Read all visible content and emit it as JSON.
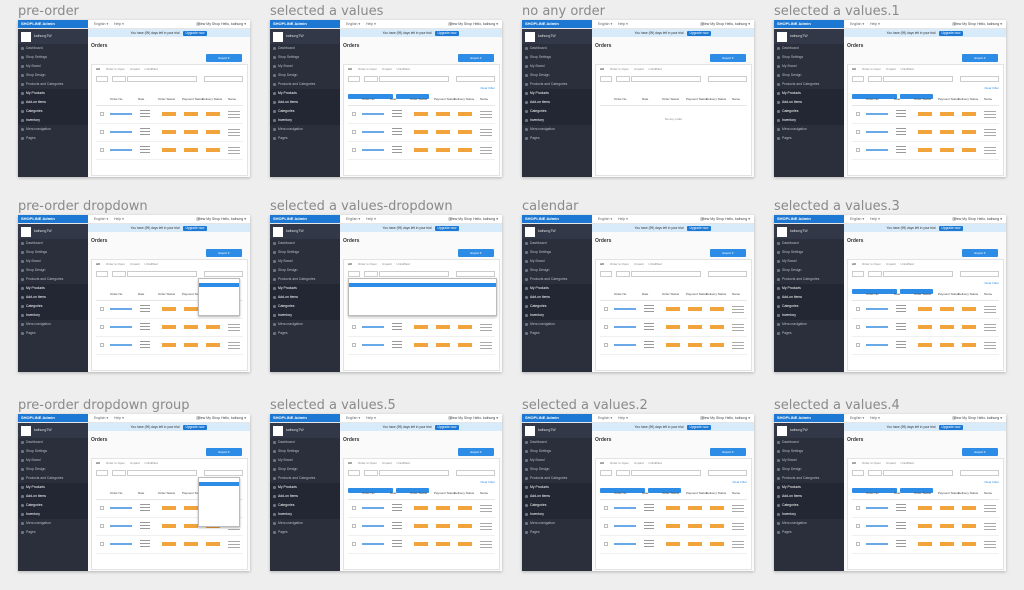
{
  "boards": [
    {
      "title": "pre-order"
    },
    {
      "title": "selected a values"
    },
    {
      "title": "no any order"
    },
    {
      "title": "selected a values.1"
    },
    {
      "title": "pre-order dropdown"
    },
    {
      "title": "selected a values-dropdown"
    },
    {
      "title": "calendar"
    },
    {
      "title": "selected a values.3"
    },
    {
      "title": "pre-order dropdown group"
    },
    {
      "title": "selected a values.5"
    },
    {
      "title": "selected a values.2"
    },
    {
      "title": "selected a values.4"
    }
  ],
  "app": {
    "brand": "SHOPLINE Admin",
    "lang": "English",
    "help": "Help",
    "right": "View My Shop   Hello, kaihung",
    "store": "kaihungTW",
    "trial": "You have (99) days left in your trial",
    "upgrade": "Upgrade now",
    "page_title": "Orders",
    "export": "Export",
    "tabs": [
      "All",
      "Order to Open",
      "Unpaid",
      "Unfulfilled"
    ],
    "empty": "No any order",
    "sidebar": [
      "Dashboard",
      "Shop Settings",
      "My Brand",
      "Shop Design",
      "Products and Categories",
      "My Products",
      "Add-on items",
      "Categories",
      "Inventory",
      "Menu navigation",
      "Pages"
    ],
    "headers": [
      "Order No.",
      "Date",
      "Order Status",
      "Payment Status",
      "Delivery Status",
      "Name"
    ],
    "clear_filter": "Clear Filter"
  },
  "colors": {
    "brand": "#1c78d2",
    "sidebar": "#2a2f3b",
    "status": "#f1a33c",
    "link": "#2d8de6"
  }
}
